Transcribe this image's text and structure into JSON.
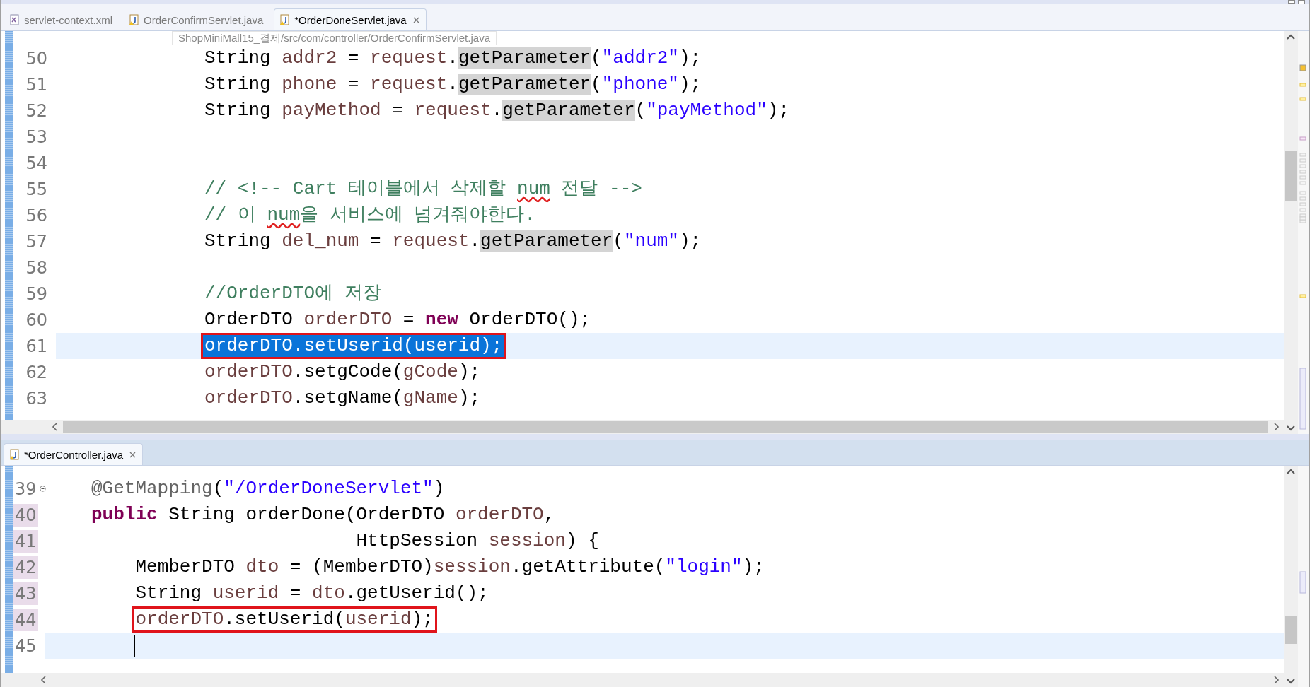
{
  "top_editor": {
    "tabs": [
      {
        "label": "servlet-context.xml",
        "kind": "xml",
        "selected": false
      },
      {
        "label": "OrderConfirmServlet.java",
        "kind": "java",
        "selected": false
      },
      {
        "label": "*OrderDoneServlet.java",
        "kind": "java",
        "selected": true
      }
    ],
    "tooltip": "ShopMiniMall15_결제/src/com/controller/OrderConfirmServlet.java",
    "lines": [
      {
        "number": "50",
        "tokens": [
          {
            "kind": "plain",
            "text": "String "
          },
          {
            "kind": "var",
            "text": "addr2"
          },
          {
            "kind": "plain",
            "text": " = "
          },
          {
            "kind": "var",
            "text": "request"
          },
          {
            "kind": "plain",
            "text": "."
          },
          {
            "kind": "occurrence",
            "text": "getParameter"
          },
          {
            "kind": "plain",
            "text": "("
          },
          {
            "kind": "string",
            "text": "\"addr2\""
          },
          {
            "kind": "plain",
            "text": ");"
          }
        ]
      },
      {
        "number": "51",
        "tokens": [
          {
            "kind": "plain",
            "text": "String "
          },
          {
            "kind": "var",
            "text": "phone"
          },
          {
            "kind": "plain",
            "text": " = "
          },
          {
            "kind": "var",
            "text": "request"
          },
          {
            "kind": "plain",
            "text": "."
          },
          {
            "kind": "occurrence",
            "text": "getParameter"
          },
          {
            "kind": "plain",
            "text": "("
          },
          {
            "kind": "string",
            "text": "\"phone\""
          },
          {
            "kind": "plain",
            "text": ");"
          }
        ]
      },
      {
        "number": "52",
        "tokens": [
          {
            "kind": "plain",
            "text": "String "
          },
          {
            "kind": "var",
            "text": "payMethod"
          },
          {
            "kind": "plain",
            "text": " = "
          },
          {
            "kind": "var",
            "text": "request"
          },
          {
            "kind": "plain",
            "text": "."
          },
          {
            "kind": "occurrence",
            "text": "getParameter"
          },
          {
            "kind": "plain",
            "text": "("
          },
          {
            "kind": "string",
            "text": "\"payMethod\""
          },
          {
            "kind": "plain",
            "text": ");"
          }
        ]
      },
      {
        "number": "53"
      },
      {
        "number": "54"
      },
      {
        "number": "55",
        "tokens": [
          {
            "kind": "comment",
            "text": "// <!-- Cart 테이블에서 삭제할 "
          },
          {
            "kind": "typo",
            "text": "num"
          },
          {
            "kind": "comment",
            "text": " 전달 -->"
          }
        ]
      },
      {
        "number": "56",
        "tokens": [
          {
            "kind": "comment",
            "text": "// 이 "
          },
          {
            "kind": "typo",
            "text": "num"
          },
          {
            "kind": "comment",
            "text": "을 서비스에 넘겨줘야한다."
          }
        ]
      },
      {
        "number": "57",
        "tokens": [
          {
            "kind": "plain",
            "text": "String "
          },
          {
            "kind": "var",
            "text": "del_num"
          },
          {
            "kind": "plain",
            "text": " = "
          },
          {
            "kind": "var",
            "text": "request"
          },
          {
            "kind": "plain",
            "text": "."
          },
          {
            "kind": "occurrence",
            "text": "getParameter"
          },
          {
            "kind": "plain",
            "text": "("
          },
          {
            "kind": "string",
            "text": "\"num\""
          },
          {
            "kind": "plain",
            "text": ");"
          }
        ]
      },
      {
        "number": "58"
      },
      {
        "number": "59",
        "tokens": [
          {
            "kind": "comment",
            "text": "//OrderDTO에 저장"
          }
        ]
      },
      {
        "number": "60",
        "tokens": [
          {
            "kind": "plain",
            "text": "OrderDTO "
          },
          {
            "kind": "var",
            "text": "orderDTO"
          },
          {
            "kind": "plain",
            "text": " = "
          },
          {
            "kind": "keyword",
            "text": "new"
          },
          {
            "kind": "plain",
            "text": " OrderDTO();"
          }
        ]
      },
      {
        "number": "61",
        "current": true,
        "selected_text": true,
        "boxed": true,
        "tokens": [
          {
            "kind": "plain",
            "text": "orderDTO.setUserid(userid);"
          }
        ]
      },
      {
        "number": "62",
        "tokens": [
          {
            "kind": "var",
            "text": "orderDTO"
          },
          {
            "kind": "plain",
            "text": ".setgCode("
          },
          {
            "kind": "var",
            "text": "gCode"
          },
          {
            "kind": "plain",
            "text": ");"
          }
        ]
      },
      {
        "number": "63",
        "tokens": [
          {
            "kind": "var",
            "text": "orderDTO"
          },
          {
            "kind": "plain",
            "text": ".setgName("
          },
          {
            "kind": "var",
            "text": "gName"
          },
          {
            "kind": "plain",
            "text": ");"
          }
        ]
      }
    ]
  },
  "bottom_editor": {
    "tabs": [
      {
        "label": "*OrderController.java",
        "kind": "java",
        "selected": true
      }
    ],
    "lines": [
      {
        "number": "39",
        "fold": true,
        "tokens": [
          {
            "kind": "annotation",
            "text": "@GetMapping"
          },
          {
            "kind": "plain",
            "text": "("
          },
          {
            "kind": "string",
            "text": "\"/OrderDoneServlet\""
          },
          {
            "kind": "plain",
            "text": ")"
          }
        ]
      },
      {
        "number": "40",
        "changed": true,
        "tokens": [
          {
            "kind": "keyword",
            "text": "public"
          },
          {
            "kind": "plain",
            "text": " String orderDone(OrderDTO "
          },
          {
            "kind": "var",
            "text": "orderDTO"
          },
          {
            "kind": "plain",
            "text": ","
          }
        ]
      },
      {
        "number": "41",
        "changed": true,
        "tokens": [
          {
            "kind": "plain",
            "text": "                        HttpSession "
          },
          {
            "kind": "var",
            "text": "session"
          },
          {
            "kind": "plain",
            "text": ") {"
          }
        ]
      },
      {
        "number": "42",
        "changed": true,
        "tokens": [
          {
            "kind": "plain",
            "text": "    MemberDTO "
          },
          {
            "kind": "var",
            "text": "dto"
          },
          {
            "kind": "plain",
            "text": " = (MemberDTO)"
          },
          {
            "kind": "var",
            "text": "session"
          },
          {
            "kind": "plain",
            "text": ".getAttribute("
          },
          {
            "kind": "string",
            "text": "\"login\""
          },
          {
            "kind": "plain",
            "text": ");"
          }
        ]
      },
      {
        "number": "43",
        "changed": true,
        "tokens": [
          {
            "kind": "plain",
            "text": "    String "
          },
          {
            "kind": "var",
            "text": "userid"
          },
          {
            "kind": "plain",
            "text": " = "
          },
          {
            "kind": "var",
            "text": "dto"
          },
          {
            "kind": "plain",
            "text": ".getUserid();"
          }
        ]
      },
      {
        "number": "44",
        "changed": true,
        "boxed": true,
        "tokens": [
          {
            "kind": "var",
            "text": "    orderDTO"
          },
          {
            "kind": "plain",
            "text": ".setUserid("
          },
          {
            "kind": "var",
            "text": "userid"
          },
          {
            "kind": "plain",
            "text": ");"
          }
        ]
      },
      {
        "number": "45",
        "current": true,
        "caret": true
      }
    ]
  }
}
